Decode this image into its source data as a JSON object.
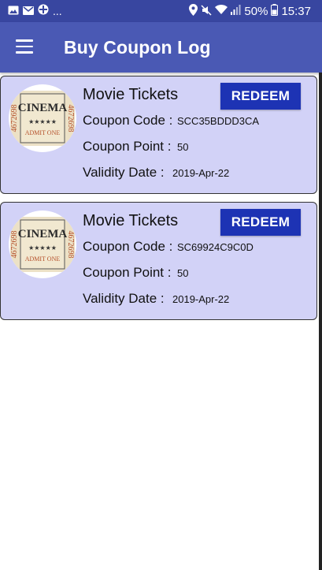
{
  "status_bar": {
    "overflow": "...",
    "battery": "50%",
    "time": "15:37"
  },
  "app_bar": {
    "title": "Buy Coupon Log"
  },
  "coupons": [
    {
      "title": "Movie Tickets",
      "redeem_label": "REDEEM",
      "code_label": "Coupon Code :",
      "code": "SCC35BDDD3CA",
      "point_label": "Coupon Point :",
      "point": "50",
      "validity_label": "Validity Date  :",
      "validity": "2019-Apr-22",
      "image": {
        "text": "CINEMA",
        "stars": "★★★★★",
        "admit": "ADMIT ONE",
        "serial": "4672698"
      }
    },
    {
      "title": "Movie Tickets",
      "redeem_label": "REDEEM",
      "code_label": "Coupon Code :",
      "code": "SC69924C9C0D",
      "point_label": "Coupon Point :",
      "point": "50",
      "validity_label": "Validity Date  :",
      "validity": "2019-Apr-22",
      "image": {
        "text": "CINEMA",
        "stars": "★★★★★",
        "admit": "ADMIT ONE",
        "serial": "4672698"
      }
    }
  ],
  "colors": {
    "status_bar": "#3846a0",
    "app_bar": "#4a59b4",
    "card_bg": "#d2d2f7",
    "redeem_bg": "#1d33b4"
  }
}
